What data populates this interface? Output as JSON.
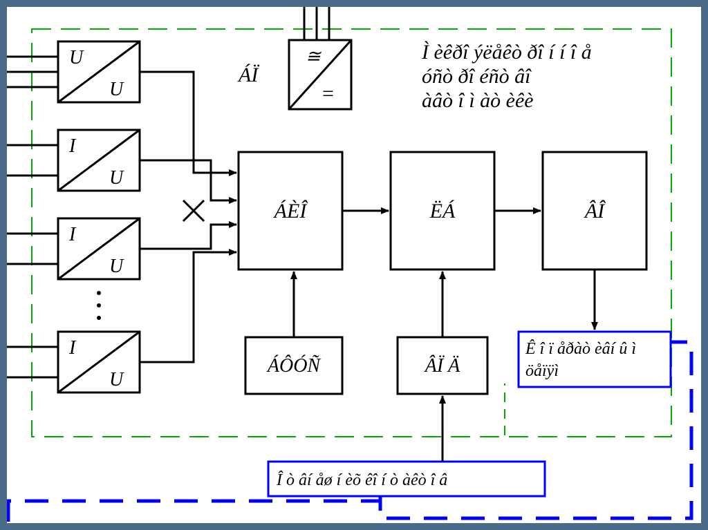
{
  "title": {
    "line1": "Ì  èêðî ýëåêò ðî í í î å",
    "line2": " óñò ðî éñò âî",
    "line3": "àâò î ì  àò èêè"
  },
  "sensors": [
    {
      "top": "U",
      "bottom": "U"
    },
    {
      "top": "I",
      "bottom": "U"
    },
    {
      "top": "I",
      "bottom": "U"
    },
    {
      "top": "I",
      "bottom": "U"
    }
  ],
  "bp": {
    "label": "ÁÏ",
    "top_sym": "≅",
    "bottom_sym": "="
  },
  "blocks": {
    "bio": "ÁÈÎ",
    "eb": "ËÁ",
    "vo": "ÂÎ",
    "afus": "ÁÔÓÑ",
    "vpd": "ÂÏ Ä"
  },
  "right_box": {
    "line1": "Ê î ï åðàò èâí û ì",
    "line2": "öåïÿì"
  },
  "bottom_box": "Î ò  âí åø í èõ êî í ò àêò î â"
}
